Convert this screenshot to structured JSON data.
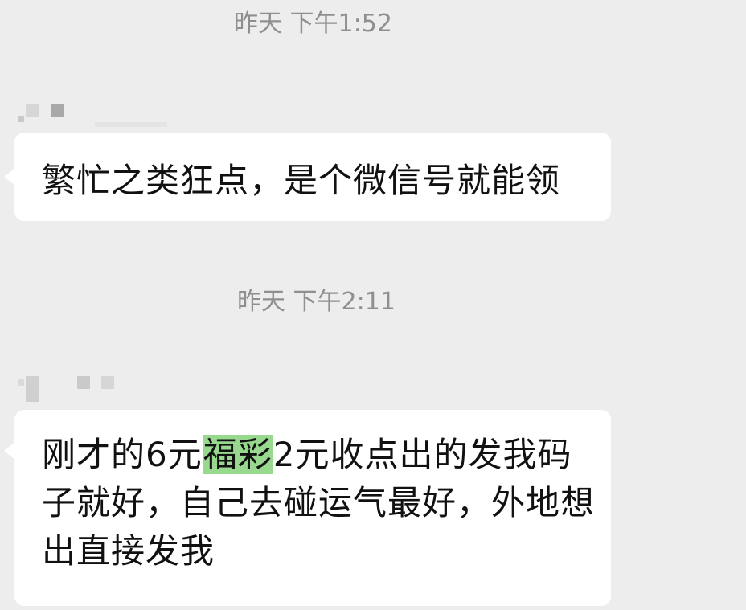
{
  "conversation": {
    "messages": [
      {
        "timestamp": "昨天 下午1:52",
        "text": "繁忙之类狂点，是个微信号就能领"
      },
      {
        "timestamp": "昨天 下午2:11",
        "text_before": "刚才的6元",
        "highlighted": "福彩",
        "text_after": "2元收点出的发我码子就好，自己去碰运气最好，外地想出直接发我"
      }
    ]
  },
  "colors": {
    "background": "#ededed",
    "bubble": "#ffffff",
    "highlight": "#98d88f",
    "timestamp_text": "#8f8f8f",
    "message_text": "#111111"
  }
}
